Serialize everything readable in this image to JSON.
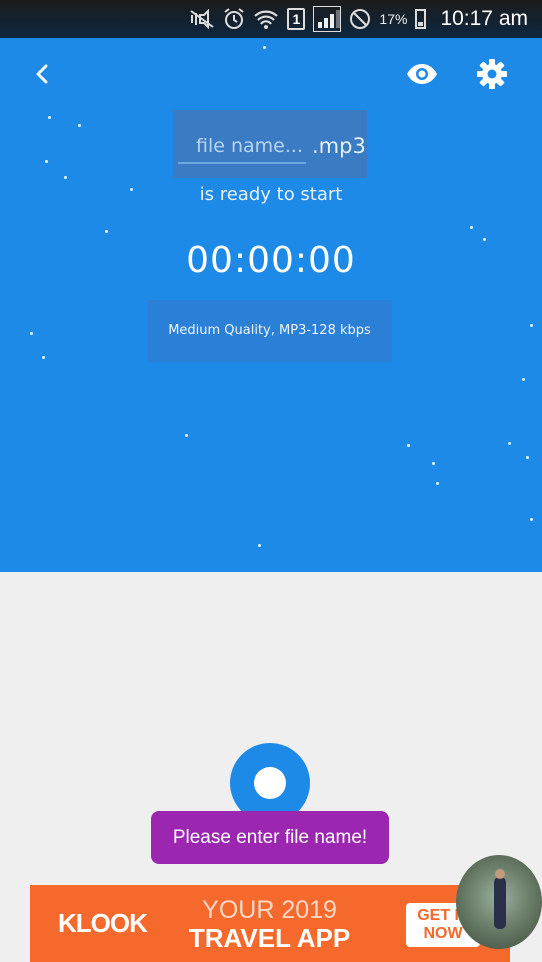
{
  "status_bar": {
    "battery_percent": "17%",
    "sim_label": "1",
    "time": "10:17 am"
  },
  "header": {
    "back_icon": "chevron-left-icon",
    "eye_icon": "eye-icon",
    "settings_icon": "gear-icon"
  },
  "recorder": {
    "file_name_placeholder": "file name...",
    "file_extension": ".mp3",
    "status_text": "is ready to start",
    "timer": "00:00:00",
    "quality_text": "Medium Quality, MP3-128 kbps"
  },
  "toast": {
    "message": "Please enter file name!"
  },
  "ad": {
    "brand": "KLOOK",
    "line1": "YOUR 2019",
    "line2": "TRAVEL APP",
    "cta_line1": "GET IT",
    "cta_line2": "NOW"
  },
  "colors": {
    "primary": "#1e8ae8",
    "toast": "#9b27b0",
    "ad": "#f56a2c"
  }
}
